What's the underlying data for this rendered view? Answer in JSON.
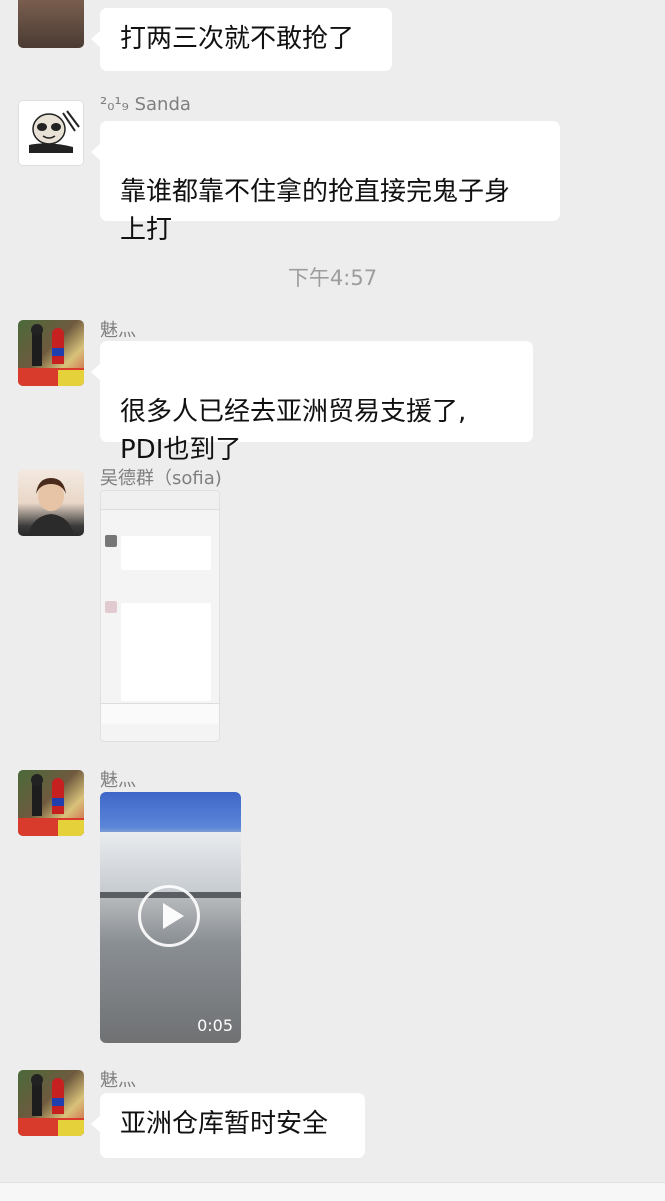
{
  "messages": [
    {
      "text": "打两三次就不敢抢了"
    },
    {
      "sender": "²₀¹₉ Sanda",
      "text": "靠谁都靠不住拿的抢直接完鬼子身\n上打"
    },
    {
      "sender": "魅灬",
      "text": "很多人已经去亚洲贸易支援了,\nPDI也到了"
    },
    {
      "sender": "吴德群（sofia)"
    },
    {
      "sender": "魅灬",
      "video_duration": "0:05"
    },
    {
      "sender": "魅灬",
      "text": "亚洲仓库暂时安全"
    }
  ],
  "time_separator": "下午4:57",
  "icons": {
    "video_play": "play-icon"
  },
  "colors": {
    "background": "#ededed",
    "bubble": "#ffffff",
    "meta_text": "#7f7f7f"
  }
}
